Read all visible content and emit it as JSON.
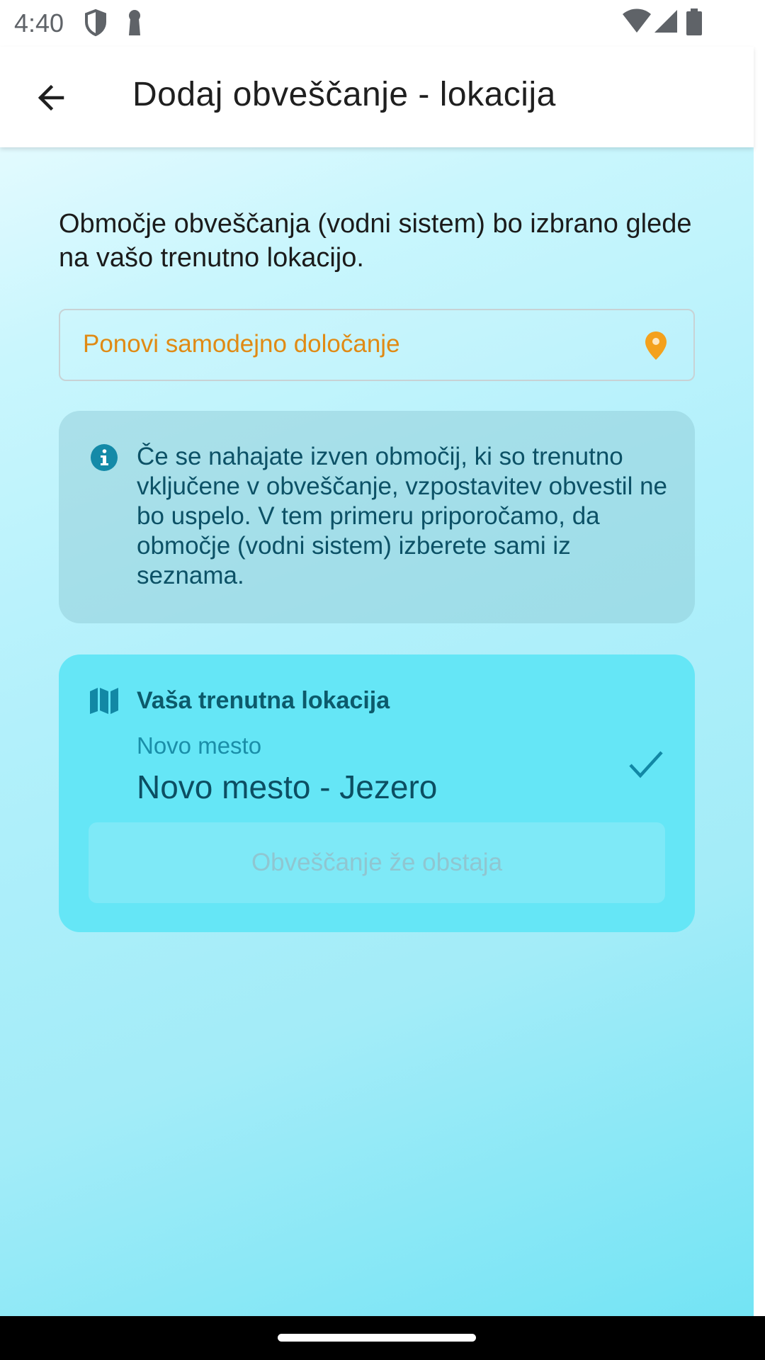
{
  "status_bar": {
    "time": "4:40",
    "left_icons": [
      "shield-icon",
      "key-icon"
    ],
    "right_icons": [
      "wifi-icon",
      "cell-signal-icon",
      "battery-icon"
    ]
  },
  "app_bar": {
    "back_icon": "arrow-back-icon",
    "title": "Dodaj obveščanje - lokacija"
  },
  "intro": {
    "text": "Območje obveščanja (vodni sistem) bo izbrano glede na vašo trenutno lokacijo."
  },
  "redetect": {
    "label": "Ponovi samodejno določanje",
    "icon": "location-pin-icon",
    "color": "#e08a14"
  },
  "info": {
    "icon": "info-icon",
    "text": "Če se nahajate izven območij, ki so trenutno vključene v obveščanje, vzpostavitev obvestil ne bo uspelo. V tem primeru priporočamo, da območje (vodni sistem) izberete sami iz seznama."
  },
  "location_card": {
    "icon": "map-icon",
    "title": "Vaša trenutna lokacija",
    "subtitle": "Novo mesto",
    "value": "Novo mesto - Jezero",
    "check_icon": "checkmark-icon",
    "button_label": "Obveščanje že obstaja",
    "background": "#65e6f6"
  }
}
